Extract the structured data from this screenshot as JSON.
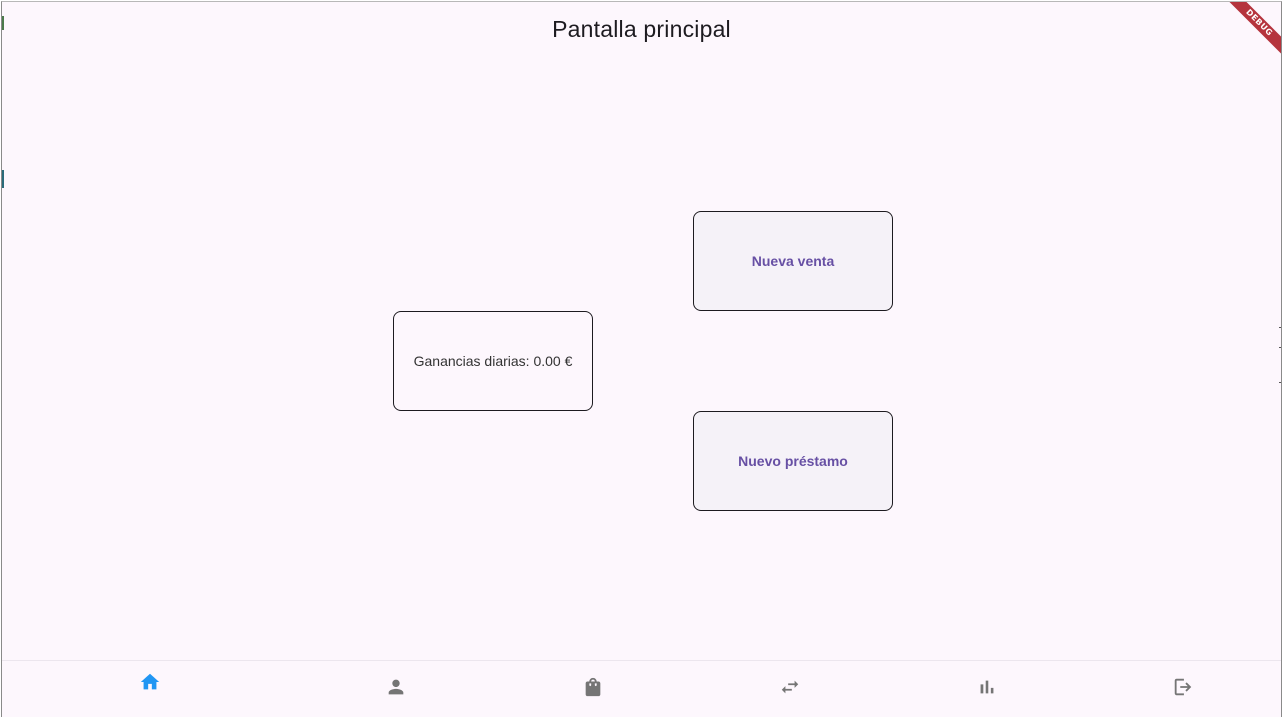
{
  "header": {
    "title": "Pantalla principal",
    "debug_label": "DEBUG"
  },
  "main": {
    "earnings_text": "Ganancias diarias: 0.00 €",
    "new_sale_label": "Nueva venta",
    "new_loan_label": "Nuevo préstamo"
  },
  "bottom_nav": {
    "items": [
      {
        "icon": "home-icon",
        "active": true
      },
      {
        "icon": "person-icon",
        "active": false
      },
      {
        "icon": "shopping-bag-icon",
        "active": false
      },
      {
        "icon": "swap-arrows-icon",
        "active": false
      },
      {
        "icon": "bar-chart-icon",
        "active": false
      },
      {
        "icon": "logout-icon",
        "active": false
      }
    ]
  },
  "colors": {
    "background": "#fdf7fd",
    "accent": "#6750a4",
    "active_nav": "#2196f3",
    "inactive_nav": "#757575",
    "debug_ribbon": "#b5343d"
  }
}
